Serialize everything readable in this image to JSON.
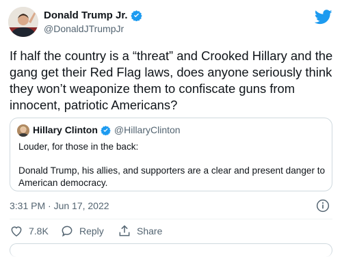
{
  "author": {
    "display_name": "Donald Trump Jr.",
    "handle": "@DonaldJTrumpJr"
  },
  "tweet_text": "If half the country is a “threat” and Crooked Hillary and the gang get their Red Flag laws, does anyone seriously think they won’t weaponize them to confiscate guns from innocent, patriotic Americans?",
  "quoted": {
    "display_name": "Hillary Clinton",
    "handle": "@HillaryClinton",
    "line1": "Louder, for those in the back:",
    "line2": "Donald Trump, his allies, and supporters are a clear and present danger to American democracy."
  },
  "timestamp": "3:31 PM · Jun 17, 2022",
  "actions": {
    "like_count": "7.8K",
    "reply_label": "Reply",
    "share_label": "Share"
  },
  "colors": {
    "verified": "#1d9bf0",
    "twitter_blue": "#1d9bf0",
    "muted_text": "#536471",
    "border": "#cfd9de"
  },
  "icons": [
    "twitter-bird-icon",
    "verified-badge-icon",
    "info-icon",
    "heart-icon",
    "reply-bubble-icon",
    "share-icon"
  ]
}
